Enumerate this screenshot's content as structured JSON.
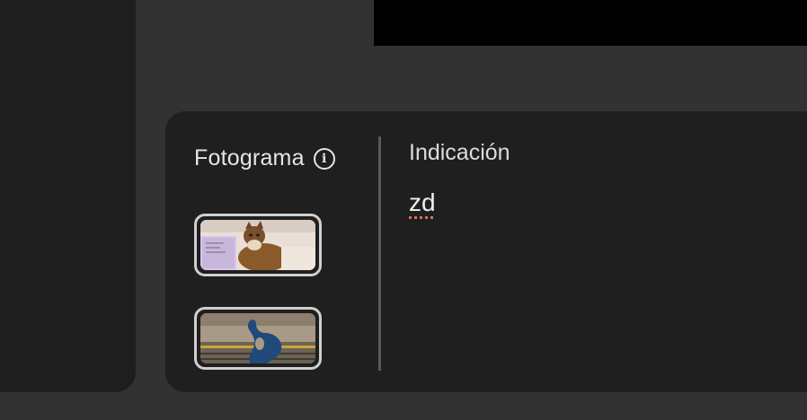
{
  "theme": {
    "background": "#323232",
    "panel": "#1f1f1f",
    "thumb_border": "#cfcfcf",
    "spellcheck_underline": "#e06a5a"
  },
  "frame_section": {
    "label": "Fotograma",
    "info_icon": "info-icon",
    "info_glyph": "i",
    "thumbnails": [
      {
        "name": "cat-and-laptop-thumbnail"
      },
      {
        "name": "blue-sculpture-thumbnail"
      }
    ]
  },
  "prompt_section": {
    "label": "Indicación",
    "value": "zd"
  }
}
